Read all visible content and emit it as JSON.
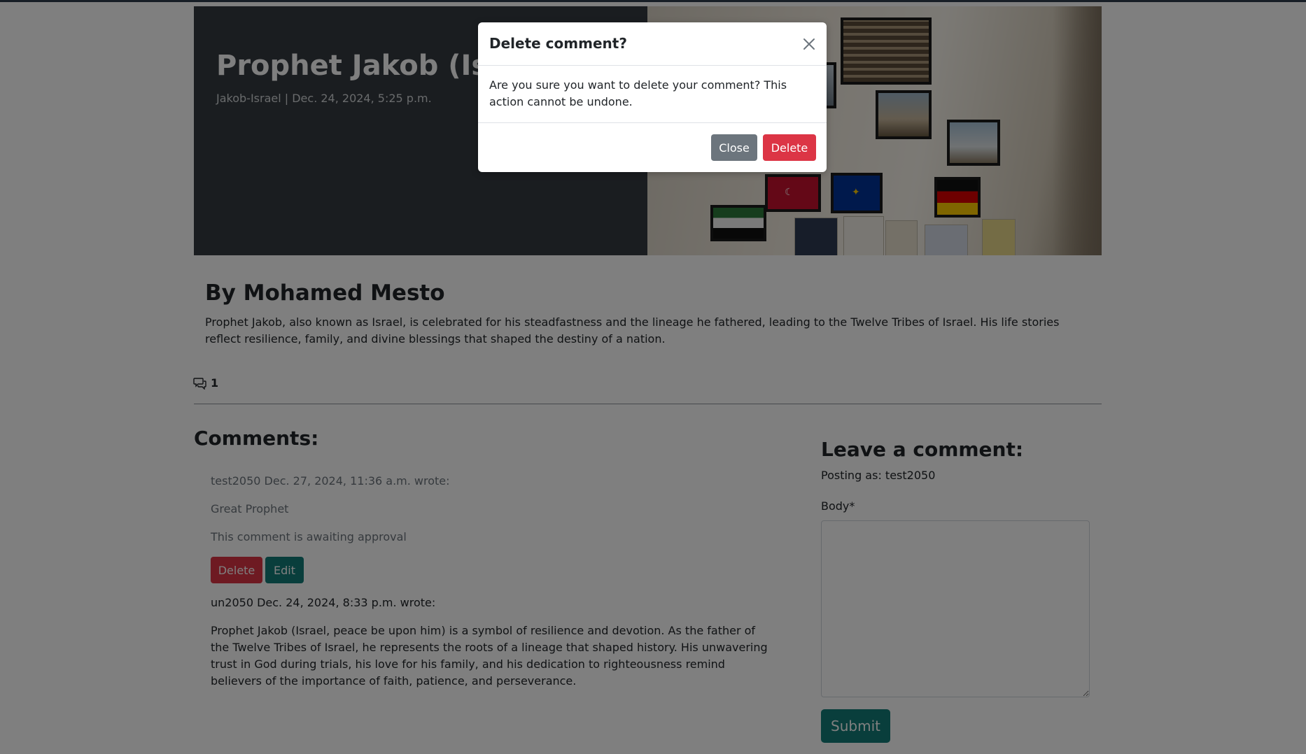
{
  "post": {
    "title": "Prophet Jakob (Israel)",
    "meta": "Jakob-Israel | Dec. 24, 2024, 5:25 p.m.",
    "author_heading": "By Mohamed Mesto",
    "excerpt": "Prophet Jakob, also known as Israel, is celebrated for his steadfastness and the lineage he fathered, leading to the Twelve Tribes of Israel. His life stories reflect resilience, family, and divine blessings that shaped the destiny of a nation.",
    "comment_count": "1",
    "comment_icon": "chat-icon"
  },
  "comments": {
    "heading": "Comments:",
    "items": [
      {
        "meta": "test2050 Dec. 27, 2024, 11:36 a.m. wrote:",
        "body": "Great Prophet",
        "status": "This comment is awaiting approval",
        "delete_label": "Delete",
        "edit_label": "Edit"
      },
      {
        "meta": "un2050 Dec. 24, 2024, 8:33 p.m. wrote:",
        "body": "Prophet Jakob (Israel, peace be upon him) is a symbol of resilience and devotion. As the father of the Twelve Tribes of Israel, he represents the roots of a lineage that shaped history. His unwavering trust in God during trials, his love for his family, and his dedication to righteousness remind believers of the importance of faith, patience, and perseverance."
      }
    ]
  },
  "comment_form": {
    "heading": "Leave a comment:",
    "posting_as": "Posting as: test2050",
    "body_label": "Body*",
    "body_value": "",
    "submit_label": "Submit"
  },
  "modal": {
    "title": "Delete comment?",
    "body": "Are you sure you want to delete your comment? This action cannot be undone.",
    "close_label": "Close",
    "delete_label": "Delete",
    "close_icon": "close-icon"
  },
  "colors": {
    "danger": "#dc3545",
    "teal": "#127c78",
    "secondary": "#6c757d",
    "hero_dark": "#343a40"
  }
}
